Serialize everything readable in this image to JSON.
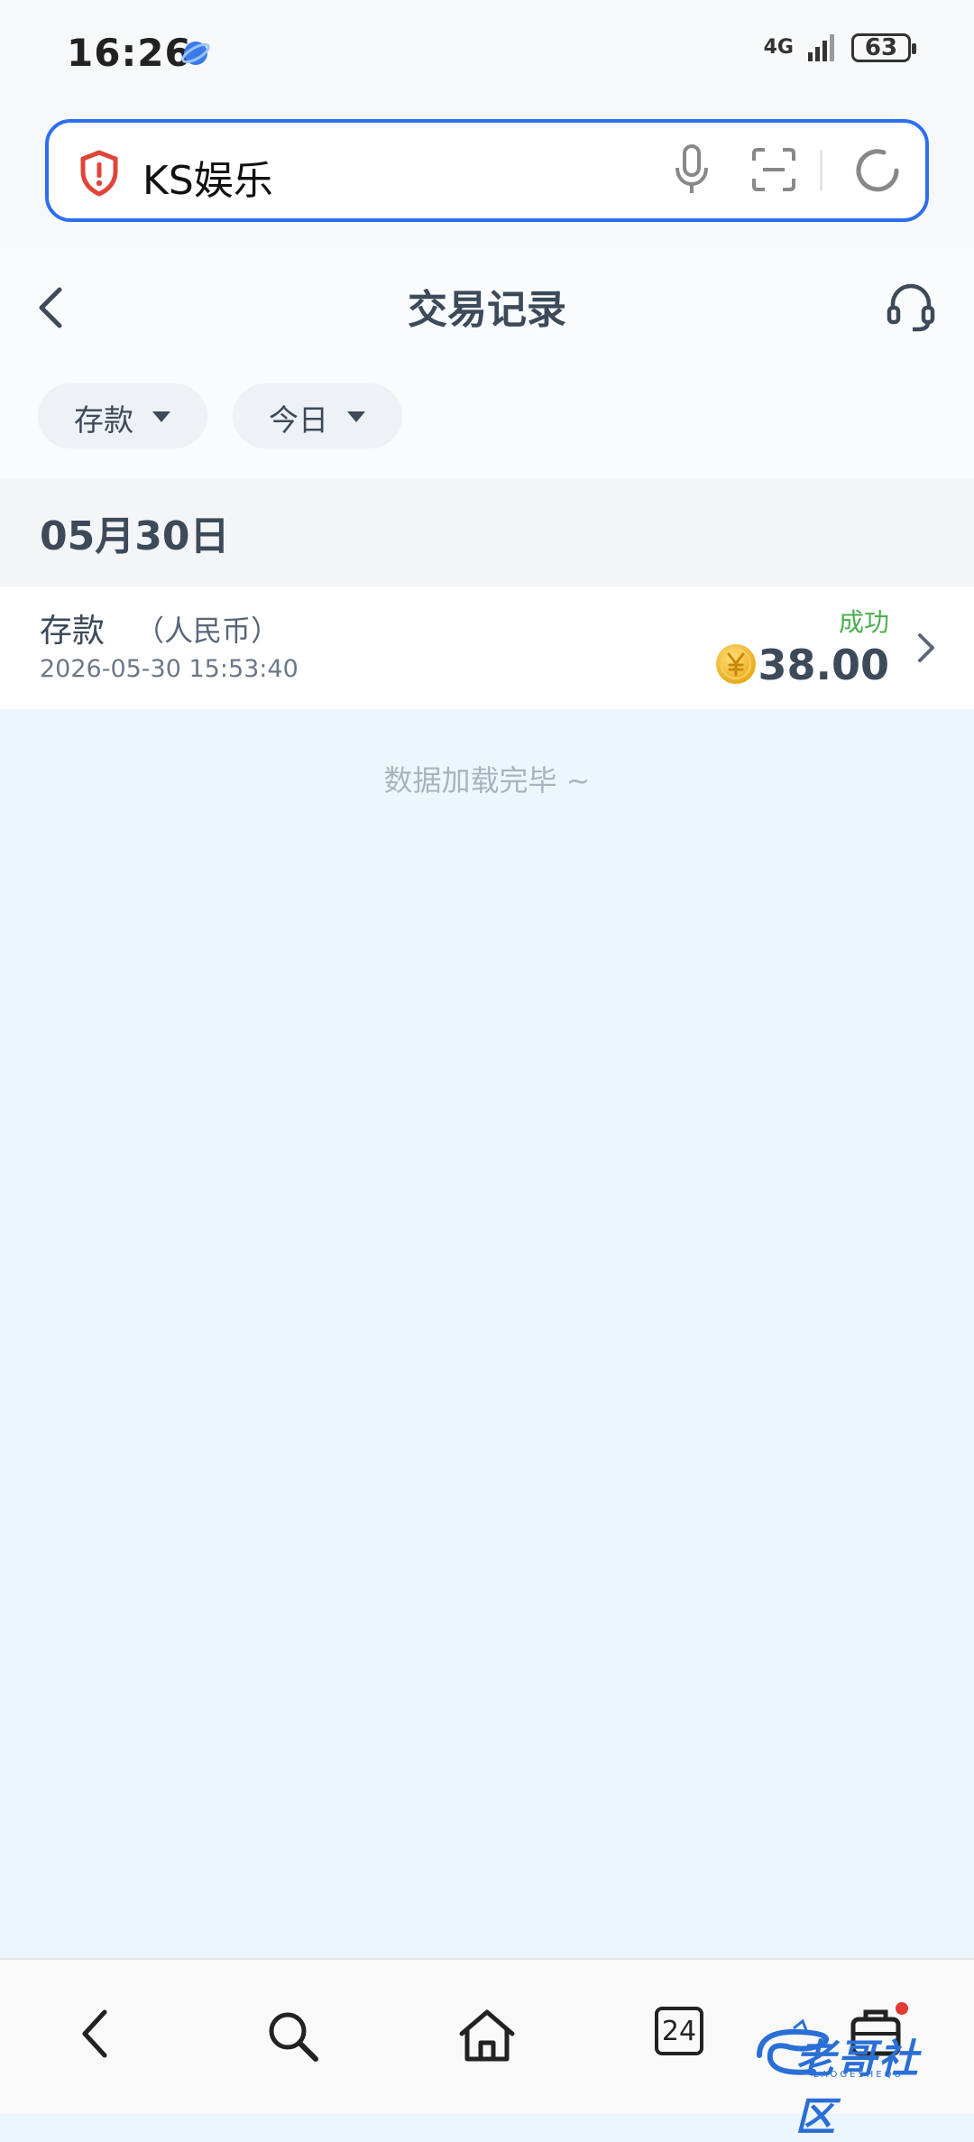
{
  "status_bar": {
    "time": "16:26",
    "network": "4G",
    "battery": "63"
  },
  "search": {
    "query": "KS娱乐"
  },
  "header": {
    "title": "交易记录"
  },
  "filters": [
    {
      "label": "存款"
    },
    {
      "label": "今日"
    }
  ],
  "date_group": {
    "label": "05月30日"
  },
  "transactions": [
    {
      "type": "存款",
      "currency": "（人民币）",
      "time": "2026-05-30 15:53:40",
      "status": "成功",
      "amount": "38.00"
    }
  ],
  "list_end_text": "数据加载完毕 ~",
  "nav": {
    "tab_count": "24"
  },
  "watermark": {
    "text": "老哥社区",
    "sub": "LAOGESHEQU"
  },
  "colors": {
    "accent": "#2d6ef0",
    "success": "#4caf50",
    "text": "#3c4a59",
    "background": "#eef6fd"
  }
}
